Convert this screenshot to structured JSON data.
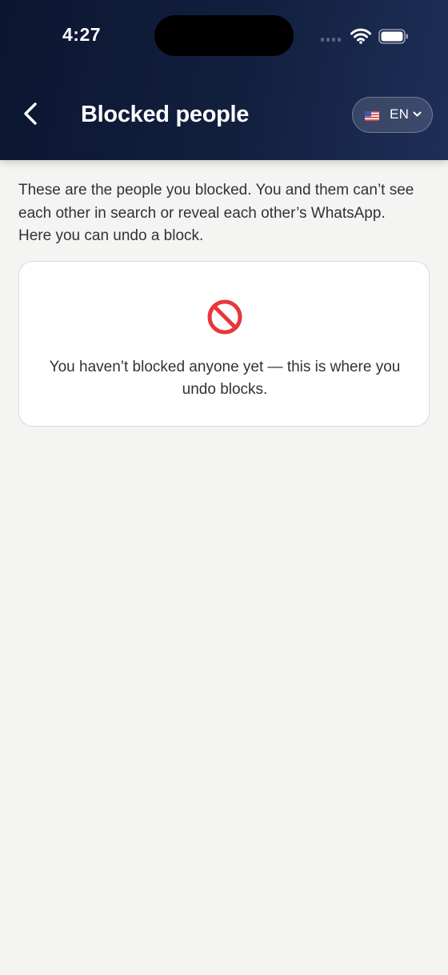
{
  "status_bar": {
    "time": "4:27"
  },
  "header": {
    "title": "Blocked people",
    "language": {
      "code": "EN",
      "flag": "us-flag-icon"
    }
  },
  "main": {
    "description": "These are the people you blocked. You and them can’t see each other in search or reveal each other’s WhatsApp. Here you can undo a block.",
    "empty_state": {
      "icon": "no-entry-icon",
      "message": "You haven’t blocked anyone yet — this is where you undo blocks."
    }
  },
  "colors": {
    "header_start": "#0b1630",
    "header_end": "#1e2e57",
    "background": "#f4f5f2",
    "card_border": "#d8dbd6",
    "no_entry_red": "#e8363c"
  }
}
